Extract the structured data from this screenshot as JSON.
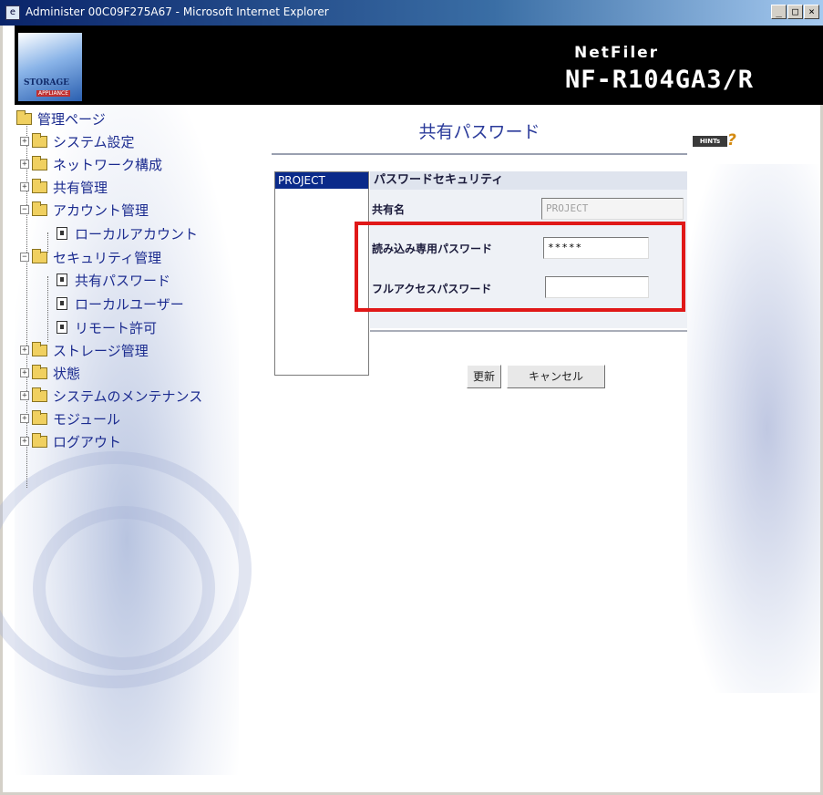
{
  "window": {
    "title": "Administer 00C09F275A67 - Microsoft Internet Explorer",
    "controls": [
      "_",
      "□",
      "×"
    ]
  },
  "header": {
    "logo_text": "STORAGE",
    "logo_sub": "APPLIANCE",
    "brand_line1": "NetFiler",
    "brand_line2": "NF-R104GA3/R"
  },
  "sidebar": {
    "items": [
      {
        "label": "管理ページ",
        "type": "folder-open",
        "indent": 0
      },
      {
        "label": "システム設定",
        "type": "folder",
        "indent": 1
      },
      {
        "label": "ネットワーク構成",
        "type": "folder",
        "indent": 1
      },
      {
        "label": "共有管理",
        "type": "folder",
        "indent": 1
      },
      {
        "label": "アカウント管理",
        "type": "folder-open",
        "indent": 1
      },
      {
        "label": "ローカルアカウント",
        "type": "doc",
        "indent": 2
      },
      {
        "label": "セキュリティ管理",
        "type": "folder-open",
        "indent": 1
      },
      {
        "label": "共有パスワード",
        "type": "doc",
        "indent": 2
      },
      {
        "label": "ローカルユーザー",
        "type": "doc",
        "indent": 2
      },
      {
        "label": "リモート許可",
        "type": "doc",
        "indent": 2
      },
      {
        "label": "ストレージ管理",
        "type": "folder",
        "indent": 1
      },
      {
        "label": "状態",
        "type": "folder",
        "indent": 1
      },
      {
        "label": "システムのメンテナンス",
        "type": "folder",
        "indent": 1
      },
      {
        "label": "モジュール",
        "type": "folder",
        "indent": 1
      },
      {
        "label": "ログアウト",
        "type": "folder",
        "indent": 1
      }
    ]
  },
  "main": {
    "title": "共有パスワード",
    "hints_label": "HINTs",
    "hints_mark": "?",
    "share_list": [
      "PROJECT"
    ],
    "panel_title": "パスワードセキュリティ",
    "share_name_label": "共有名",
    "share_name_value": "PROJECT",
    "readonly_password_label": "読み込み専用パスワード",
    "readonly_password_value": "*****",
    "fullaccess_password_label": "フルアクセスパスワード",
    "fullaccess_password_value": "",
    "update_button": "更新",
    "cancel_button": "キャンセル"
  }
}
